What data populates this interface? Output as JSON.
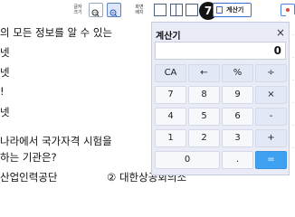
{
  "toolbar": {
    "font_size_label_1": "글자",
    "font_size_label_2": "크기",
    "zoom_in_sub": "기본",
    "zoom_out_sub": "",
    "layout_label_1": "화면",
    "layout_label_2": "배치",
    "calc_button_label": "계산기",
    "step_badge": "7"
  },
  "question": {
    "line1": "의 모든 정보를 알 수 있는",
    "opt1": "넷",
    "opt2": "넷",
    "opt3": "!",
    "opt4": "넷",
    "q2_line1": "나라에서 국가자격 시험을",
    "q2_line2": "하는 기관은?",
    "q2_ans1": "산업인력공단",
    "q2_ans2_num": "②",
    "q2_ans2": "대한상공회의소"
  },
  "calculator": {
    "title": "계산기",
    "close": "×",
    "display": "0",
    "keys": [
      [
        "CA",
        "←",
        "%",
        "÷"
      ],
      [
        "7",
        "8",
        "9",
        "×"
      ],
      [
        "4",
        "5",
        "6",
        "-"
      ],
      [
        "1",
        "2",
        "3",
        "+"
      ],
      [
        "0",
        ".",
        "="
      ]
    ]
  }
}
